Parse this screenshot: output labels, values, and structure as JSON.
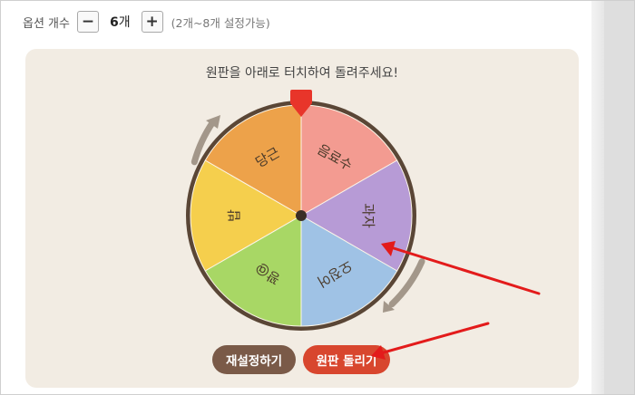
{
  "options": {
    "label": "옵션 개수",
    "count": "6",
    "count_unit": "개",
    "range": "(2개~8개 설정가능)",
    "minus_icon": "minus-icon",
    "plus_icon": "plus-icon"
  },
  "wheel": {
    "instruction": "원판을 아래로 터치하여 돌려주세요!",
    "segments": [
      {
        "label": "밥",
        "color": "#f5cf4d"
      },
      {
        "label": "당근",
        "color": "#eda24a"
      },
      {
        "label": "음료수",
        "color": "#f39b91"
      },
      {
        "label": "과자",
        "color": "#b79bd6"
      },
      {
        "label": "오징어",
        "color": "#9fc2e5"
      },
      {
        "label": "꽝@",
        "color": "#a8d765"
      }
    ],
    "pointer_color": "#e8352a",
    "rim_color": "#5a4636"
  },
  "buttons": {
    "reset_label": "재설정하기",
    "spin_label": "원판 돌리기"
  },
  "colors": {
    "card_background": "#f2ece3",
    "spin_button": "#d8462e",
    "reset_button": "#7a5a48",
    "annotation_arrow": "#e31b1b"
  }
}
